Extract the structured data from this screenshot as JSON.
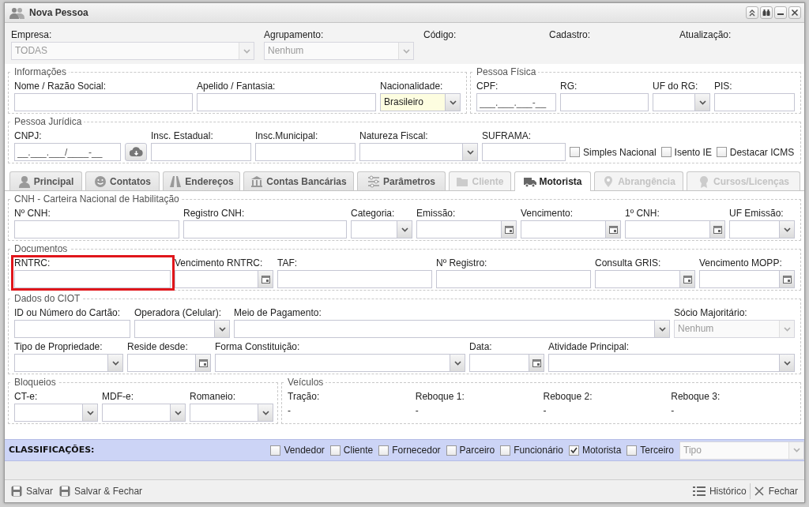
{
  "window": {
    "title": "Nova Pessoa"
  },
  "header": {
    "fields": [
      {
        "label": "Empresa:",
        "kind": "select",
        "value": "TODAS",
        "disabled": true
      },
      {
        "label": "Agrupamento:",
        "kind": "select",
        "value": "Nenhum",
        "disabled": true
      },
      {
        "label": "Código:",
        "kind": "info"
      },
      {
        "label": "Cadastro:",
        "kind": "info"
      },
      {
        "label": "Atualização:",
        "kind": "info"
      }
    ]
  },
  "upper_sections": [
    [
      {
        "legend": "Informações",
        "rows": [
          [
            {
              "label": "Nome / Razão Social:",
              "kind": "text"
            },
            {
              "label": "Apelido / Fantasia:",
              "kind": "text"
            },
            {
              "label": "Nacionalidade:",
              "kind": "select",
              "value": "Brasileiro",
              "disabled": false,
              "highlighted": true
            }
          ]
        ]
      },
      {
        "legend": "Pessoa Física",
        "rows": [
          [
            {
              "label": "CPF:",
              "kind": "masked",
              "placeholder": "___.___.___-__"
            },
            {
              "label": "RG:",
              "kind": "text"
            },
            {
              "label": "UF do RG:",
              "kind": "select",
              "disabled": false
            },
            {
              "label": "PIS:",
              "kind": "text"
            }
          ]
        ]
      }
    ],
    [
      {
        "legend": "Pessoa Jurídica",
        "rows": [
          [
            {
              "label": "CNPJ:",
              "kind": "masked",
              "placeholder": "__.___.___/____-__"
            },
            {
              "kind": "action"
            },
            {
              "label": "Insc. Estadual:",
              "kind": "text"
            },
            {
              "label": "Insc.Municipal:",
              "kind": "text"
            },
            {
              "label": "Natureza Fiscal:",
              "kind": "select",
              "disabled": false
            },
            {
              "label": "SUFRAMA:",
              "kind": "text"
            },
            {
              "label": "Simples Nacional",
              "kind": "checkbox",
              "checked": false
            },
            {
              "label": "Isento IE",
              "kind": "checkbox",
              "checked": false
            },
            {
              "label": "Destacar ICMS",
              "kind": "checkbox",
              "checked": false
            }
          ]
        ]
      }
    ]
  ],
  "tabs": [
    {
      "label": "Principal",
      "selected": false,
      "disabled": false
    },
    {
      "label": "Contatos",
      "selected": false,
      "disabled": false
    },
    {
      "label": "Endereços",
      "selected": false,
      "disabled": false
    },
    {
      "label": "Contas Bancárias",
      "selected": false,
      "disabled": false
    },
    {
      "label": "Parâmetros",
      "selected": false,
      "disabled": false
    },
    {
      "label": "Cliente",
      "selected": false,
      "disabled": true
    },
    {
      "label": "Motorista",
      "selected": true,
      "disabled": false
    },
    {
      "label": "Abrangência",
      "selected": false,
      "disabled": true
    },
    {
      "label": "Cursos/Licenças",
      "selected": false,
      "disabled": true
    }
  ],
  "tab_sections": [
    [
      {
        "legend": "CNH - Carteira Nacional de Habilitação",
        "rows": [
          [
            {
              "label": "Nº CNH:",
              "kind": "text"
            },
            {
              "label": "Registro CNH:",
              "kind": "text"
            },
            {
              "label": "Categoria:",
              "kind": "select",
              "disabled": false
            },
            {
              "label": "Emissão:",
              "kind": "date"
            },
            {
              "label": "Vencimento:",
              "kind": "date"
            },
            {
              "label": "1º CNH:",
              "kind": "date"
            },
            {
              "label": "UF Emissão:",
              "kind": "select",
              "disabled": false
            }
          ]
        ]
      }
    ],
    [
      {
        "legend": "Documentos",
        "rows": [
          [
            {
              "label": "RNTRC:",
              "kind": "text",
              "invalid": true
            },
            {
              "label": "Vencimento RNTRC:",
              "kind": "date"
            },
            {
              "label": "TAF:",
              "kind": "text"
            },
            {
              "label": "Nº Registro:",
              "kind": "text"
            },
            {
              "label": "Consulta GRIS:",
              "kind": "date"
            },
            {
              "label": "Vencimento MOPP:",
              "kind": "date"
            }
          ]
        ]
      }
    ],
    [
      {
        "legend": "Dados do CIOT",
        "rows": [
          [
            {
              "label": "ID ou Número do Cartão:",
              "kind": "text"
            },
            {
              "label": "Operadora (Celular):",
              "kind": "select",
              "disabled": false
            },
            {
              "label": "Meio de Pagamento:",
              "kind": "select",
              "disabled": false
            },
            {
              "label": "Sócio Majoritário:",
              "kind": "select",
              "value": "Nenhum",
              "disabled": true
            }
          ],
          [
            {
              "label": "Tipo de Propriedade:",
              "kind": "select",
              "disabled": false
            },
            {
              "label": "Reside desde:",
              "kind": "date"
            },
            {
              "label": "Forma Constituição:",
              "kind": "select",
              "disabled": false
            },
            {
              "label": "Data:",
              "kind": "date"
            },
            {
              "label": "Atividade Principal:",
              "kind": "select",
              "disabled": false
            }
          ]
        ]
      }
    ],
    [
      {
        "legend": "Bloqueios",
        "rows": [
          [
            {
              "label": "CT-e:",
              "kind": "select",
              "disabled": false
            },
            {
              "label": "MDF-e:",
              "kind": "select",
              "disabled": false
            },
            {
              "label": "Romaneio:",
              "kind": "select",
              "disabled": false
            }
          ]
        ]
      },
      {
        "legend": "Veículos",
        "rows": [
          [
            {
              "label": "Tração:",
              "kind": "readonly",
              "value": "-"
            },
            {
              "label": "Reboque 1:",
              "kind": "readonly",
              "value": "-"
            },
            {
              "label": "Reboque 2:",
              "kind": "readonly",
              "value": "-"
            },
            {
              "label": "Reboque 3:",
              "kind": "readonly",
              "value": "-"
            }
          ]
        ]
      }
    ]
  ],
  "classifications": {
    "label": "CLASSIFICAÇÕES:",
    "options": [
      {
        "label": "Vendedor",
        "checked": false
      },
      {
        "label": "Cliente",
        "checked": false
      },
      {
        "label": "Fornecedor",
        "checked": false
      },
      {
        "label": "Parceiro",
        "checked": false
      },
      {
        "label": "Funcionário",
        "checked": false
      },
      {
        "label": "Motorista",
        "checked": true
      },
      {
        "label": "Terceiro",
        "checked": false
      }
    ],
    "type_select": {
      "placeholder": "Tipo",
      "disabled": true
    }
  },
  "footer": {
    "left_buttons": [
      "Salvar",
      "Salvar & Fechar"
    ],
    "right_buttons": [
      "Histórico",
      "Fechar"
    ]
  }
}
